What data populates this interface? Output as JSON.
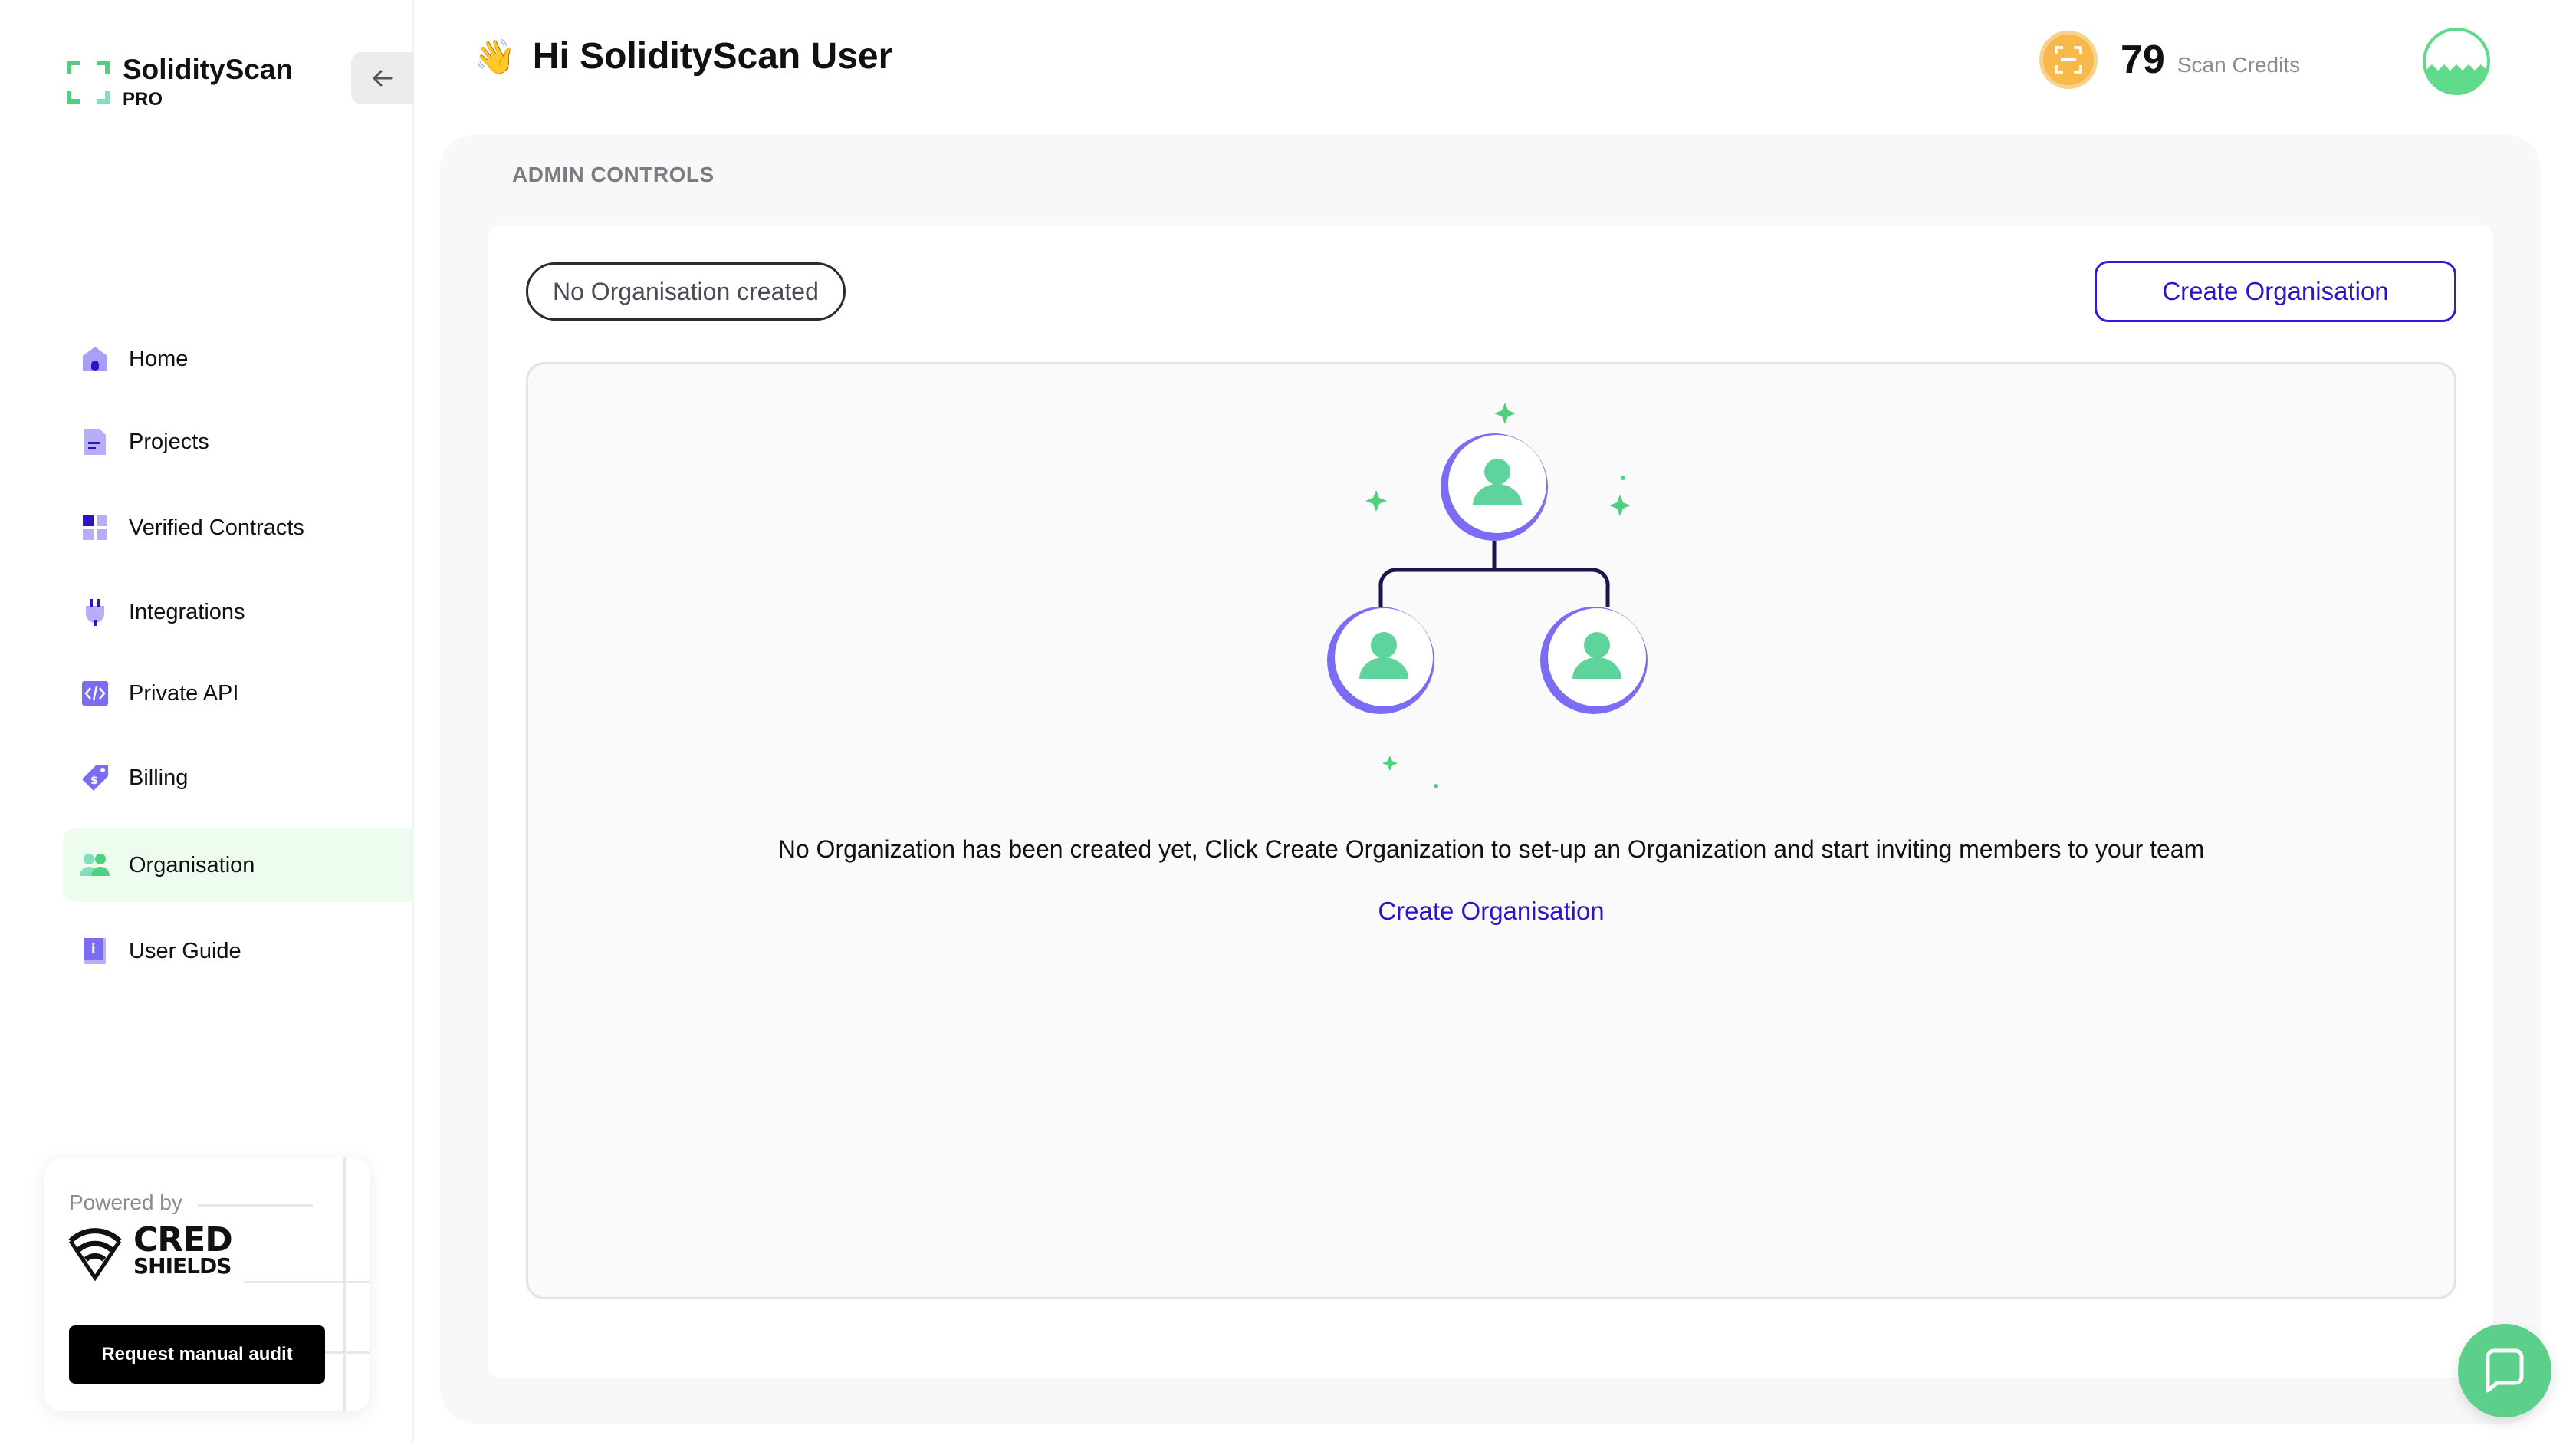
{
  "sidebar": {
    "brand": {
      "title": "SolidityScan",
      "subtitle": "PRO"
    },
    "collapse_icon": "arrow-left-icon",
    "items": [
      {
        "label": "Home",
        "icon": "home-icon",
        "active": false
      },
      {
        "label": "Projects",
        "icon": "document-icon",
        "active": false
      },
      {
        "label": "Verified Contracts",
        "icon": "grid-icon",
        "active": false
      },
      {
        "label": "Integrations",
        "icon": "plug-icon",
        "active": false
      },
      {
        "label": "Private API",
        "icon": "code-icon",
        "active": false
      },
      {
        "label": "Billing",
        "icon": "tag-icon",
        "active": false
      },
      {
        "label": "Organisation",
        "icon": "team-icon",
        "active": true
      },
      {
        "label": "User Guide",
        "icon": "book-icon",
        "active": false
      }
    ],
    "powered": {
      "label": "Powered by",
      "brand_line1": "CRED",
      "brand_line2": "SHIELDS",
      "button": "Request manual audit"
    }
  },
  "header": {
    "wave": "👋",
    "greeting": "Hi SolidityScan User",
    "credits_value": "79",
    "credits_label": "Scan Credits"
  },
  "main": {
    "section_label": "ADMIN CONTROLS",
    "org_status": "No Organisation created",
    "create_button": "Create Organisation",
    "empty_message": "No Organization has been created yet, Click Create Organization to set-up an Organization and start inviting members to your team",
    "empty_link": "Create Organisation"
  },
  "colors": {
    "accent": "#2e14c8",
    "green": "#5ccf8a",
    "active_bg": "#eefcef",
    "purple_icon": "#7b6cf6"
  }
}
